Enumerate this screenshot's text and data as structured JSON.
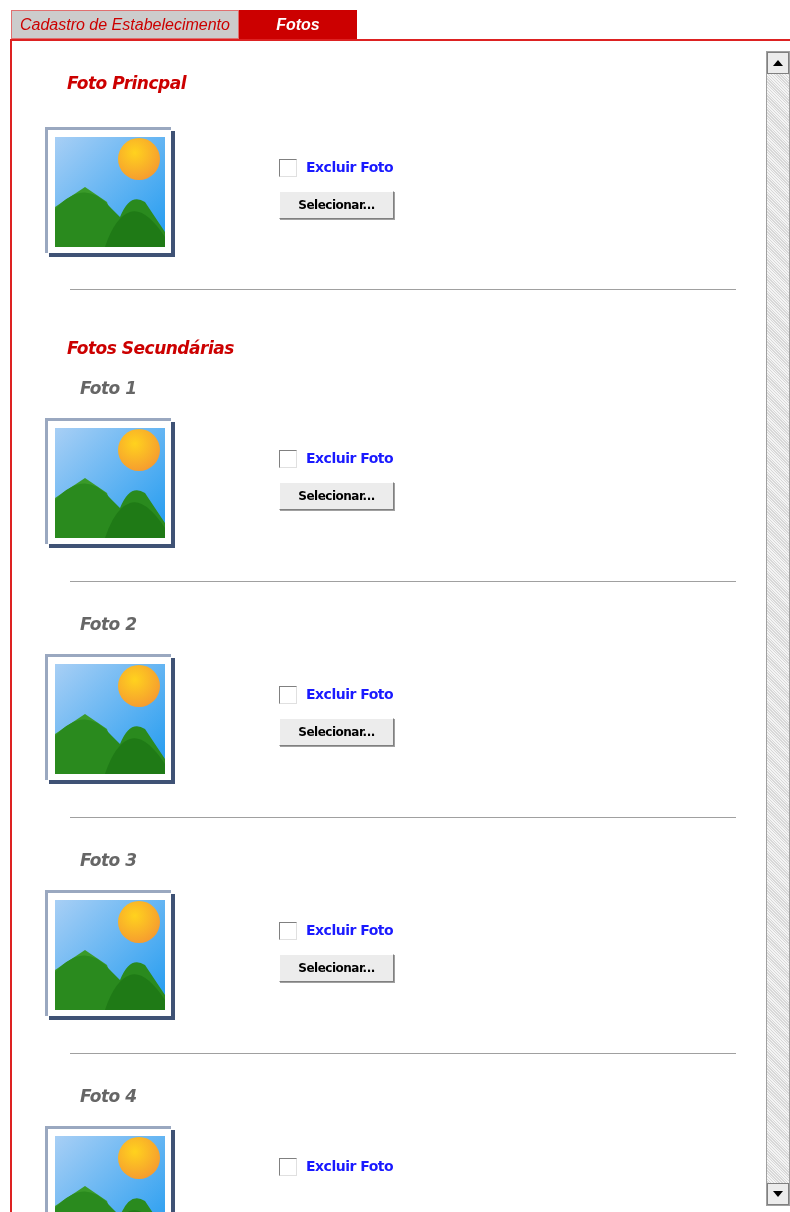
{
  "tabs": [
    {
      "label": "Cadastro de Estabelecimento",
      "selected": false
    },
    {
      "label": "Fotos",
      "selected": true
    }
  ],
  "main_photo": {
    "title": "Foto Princpal",
    "exclude_label": "Excluir Foto",
    "checked": false,
    "button": "Selecionar..."
  },
  "secondary": {
    "title": "Fotos Secundárias",
    "photos": [
      {
        "label": "Foto 1",
        "exclude_label": "Excluir Foto",
        "checked": false,
        "button": "Selecionar..."
      },
      {
        "label": "Foto 2",
        "exclude_label": "Excluir Foto",
        "checked": false,
        "button": "Selecionar..."
      },
      {
        "label": "Foto 3",
        "exclude_label": "Excluir Foto",
        "checked": false,
        "button": "Selecionar..."
      },
      {
        "label": "Foto 4",
        "exclude_label": "Excluir Foto",
        "checked": false
      }
    ]
  }
}
